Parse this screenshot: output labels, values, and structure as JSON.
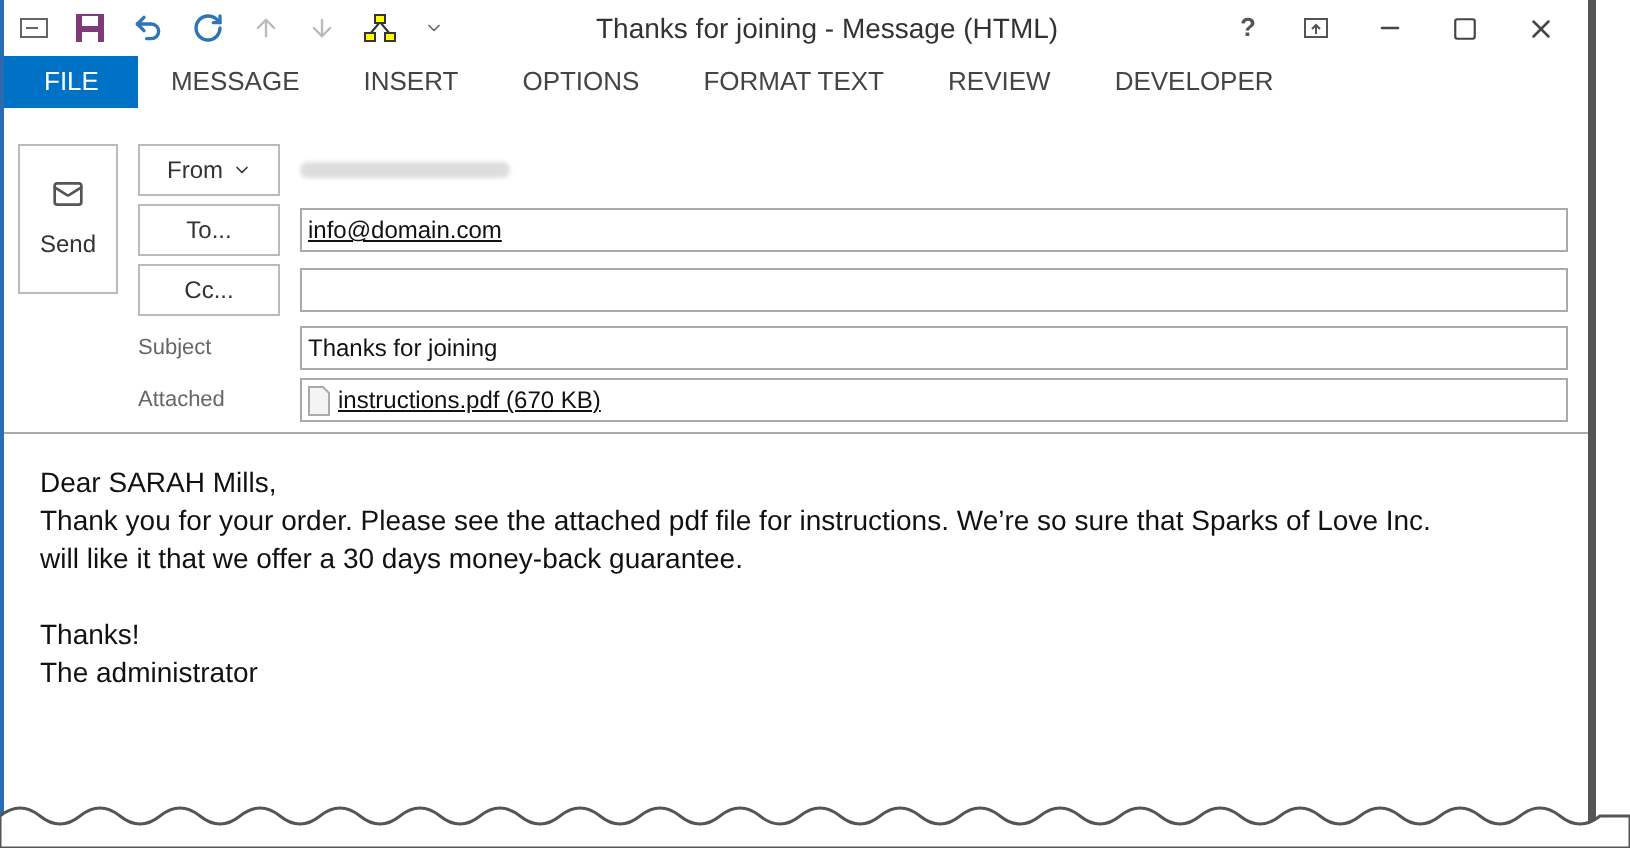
{
  "window": {
    "title": "Thanks for joining - Message (HTML)",
    "help": "?"
  },
  "ribbon_tabs": [
    {
      "label": "FILE",
      "selected": true
    },
    {
      "label": "MESSAGE",
      "selected": false
    },
    {
      "label": "INSERT",
      "selected": false
    },
    {
      "label": "OPTIONS",
      "selected": false
    },
    {
      "label": "FORMAT TEXT",
      "selected": false
    },
    {
      "label": "REVIEW",
      "selected": false
    },
    {
      "label": "DEVELOPER",
      "selected": false
    }
  ],
  "send_button": {
    "label": "Send"
  },
  "header": {
    "from": {
      "label": "From"
    },
    "to": {
      "label": "To...",
      "value": "info@domain.com"
    },
    "cc": {
      "label": "Cc..."
    },
    "subject": {
      "label": "Subject",
      "value": "Thanks for joining"
    },
    "attached": {
      "label": "Attached",
      "file": "instructions.pdf (670 KB)"
    }
  },
  "body": {
    "paragraphs": [
      [
        "Dear SARAH Mills,",
        "Thank you for your order. Please see the attached pdf file for instructions. We’re so sure that Sparks of Love Inc.",
        "will like it that we offer a 30 days money-back guarantee."
      ],
      [
        "Thanks!",
        "The administrator"
      ]
    ]
  }
}
